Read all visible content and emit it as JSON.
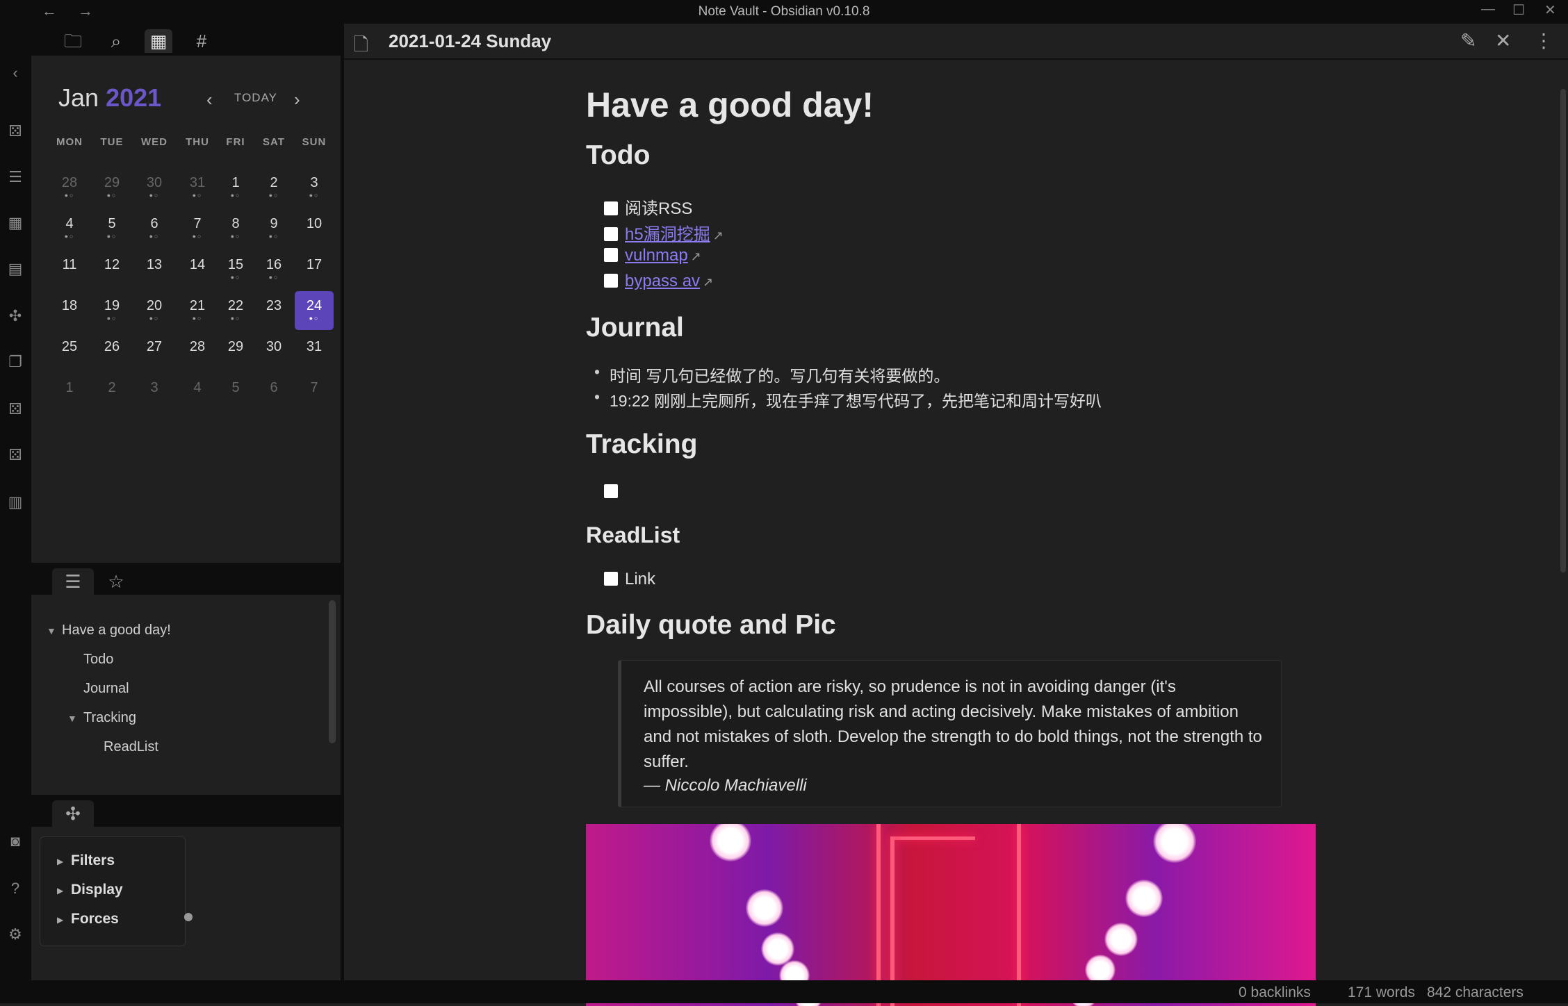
{
  "window": {
    "title": "Note Vault - Obsidian v0.10.8",
    "nav_back": "←",
    "nav_forward": "→",
    "minimize": "—",
    "maximize": "☐",
    "close": "✕"
  },
  "ribbon": {
    "icons": [
      "collapse-left-icon",
      "dice-icon",
      "list-icon",
      "calendar-check-icon",
      "checklist-icon",
      "graph-icon",
      "copy-icon",
      "dice-icon-2",
      "dice-icon-3",
      "table-icon",
      "camera-icon",
      "help-icon",
      "settings-icon"
    ]
  },
  "left_tabs": {
    "icons": [
      "folder-icon",
      "search-icon",
      "calendar-icon",
      "hashtag-icon"
    ],
    "active": "calendar-icon"
  },
  "calendar": {
    "month": "Jan",
    "year": "2021",
    "today_label": "TODAY",
    "prev": "‹",
    "next": "›",
    "weekdays": [
      "MON",
      "TUE",
      "WED",
      "THU",
      "FRI",
      "SAT",
      "SUN"
    ],
    "weeks": [
      [
        {
          "d": "28",
          "dim": true,
          "dots": "●○"
        },
        {
          "d": "29",
          "dim": true,
          "dots": "●○"
        },
        {
          "d": "30",
          "dim": true,
          "dots": "●○"
        },
        {
          "d": "31",
          "dim": true,
          "dots": "●○"
        },
        {
          "d": "1",
          "dots": "●○"
        },
        {
          "d": "2",
          "dots": "●○"
        },
        {
          "d": "3",
          "dots": "●○"
        }
      ],
      [
        {
          "d": "4",
          "dots": "●○"
        },
        {
          "d": "5",
          "dots": "●○"
        },
        {
          "d": "6",
          "dots": "●○"
        },
        {
          "d": "7",
          "dots": "●○"
        },
        {
          "d": "8",
          "dots": "●○"
        },
        {
          "d": "9",
          "dots": "●○"
        },
        {
          "d": "10",
          "dots": ""
        }
      ],
      [
        {
          "d": "11",
          "dots": ""
        },
        {
          "d": "12",
          "dots": ""
        },
        {
          "d": "13",
          "dots": ""
        },
        {
          "d": "14",
          "dots": ""
        },
        {
          "d": "15",
          "dots": "●○"
        },
        {
          "d": "16",
          "dots": "●○"
        },
        {
          "d": "17",
          "dots": ""
        }
      ],
      [
        {
          "d": "18",
          "dots": ""
        },
        {
          "d": "19",
          "dots": "●○"
        },
        {
          "d": "20",
          "dots": "●○"
        },
        {
          "d": "21",
          "dots": "●○"
        },
        {
          "d": "22",
          "dots": "●○"
        },
        {
          "d": "23",
          "dots": ""
        },
        {
          "d": "24",
          "dots": "●○",
          "selected": true
        }
      ],
      [
        {
          "d": "25",
          "dots": ""
        },
        {
          "d": "26",
          "dots": ""
        },
        {
          "d": "27",
          "dots": ""
        },
        {
          "d": "28",
          "dots": ""
        },
        {
          "d": "29",
          "dots": ""
        },
        {
          "d": "30",
          "dots": ""
        },
        {
          "d": "31",
          "dots": ""
        }
      ],
      [
        {
          "d": "1",
          "dim": true,
          "dots": ""
        },
        {
          "d": "2",
          "dim": true,
          "dots": ""
        },
        {
          "d": "3",
          "dim": true,
          "dots": ""
        },
        {
          "d": "4",
          "dim": true,
          "dots": ""
        },
        {
          "d": "5",
          "dim": true,
          "dots": ""
        },
        {
          "d": "6",
          "dim": true,
          "dots": ""
        },
        {
          "d": "7",
          "dim": true,
          "dots": ""
        }
      ]
    ]
  },
  "outline_tabs": {
    "icons": [
      "outline-list-icon",
      "star-icon"
    ]
  },
  "outline": {
    "items": [
      {
        "label": "Have a good day!",
        "level": 0,
        "caret": true
      },
      {
        "label": "Todo",
        "level": 1
      },
      {
        "label": "Journal",
        "level": 1
      },
      {
        "label": "Tracking",
        "level": 1,
        "caret": true
      },
      {
        "label": "ReadList",
        "level": 2
      }
    ]
  },
  "graph_panel": {
    "tab_icon": "graph-icon",
    "controls": [
      "Filters",
      "Display",
      "Forces"
    ]
  },
  "editor": {
    "file_title": "2021-01-24 Sunday",
    "header_buttons": [
      "edit-icon",
      "close-icon",
      "more-options-icon"
    ],
    "h1": "Have a good day!",
    "sections": {
      "todo": {
        "heading": "Todo",
        "tasks": [
          {
            "text": "阅读RSS",
            "link": false
          },
          {
            "text": "h5漏洞挖掘",
            "link": true
          },
          {
            "text": "vulnmap",
            "link": true
          },
          {
            "text": "bypass av",
            "link": true
          }
        ]
      },
      "journal": {
        "heading": "Journal",
        "bullets": [
          "时间 写几句已经做了的。写几句有关将要做的。",
          "19:22 刚刚上完厕所，现在手痒了想写代码了，先把笔记和周计写好叭"
        ]
      },
      "tracking": {
        "heading": "Tracking",
        "tasks": [
          {
            "text": ""
          }
        ]
      },
      "readlist": {
        "heading": "ReadList",
        "tasks": [
          {
            "text": "Link"
          }
        ]
      },
      "daily": {
        "heading": "Daily quote and Pic",
        "quote": "All courses of action are risky, so prudence is not in avoiding danger (it's impossible), but calculating risk and acting decisively. Make mistakes of ambition and not mistakes of sloth. Develop the strength to do bold things, not the strength to suffer.",
        "author": "— Niccolo Machiavelli"
      }
    }
  },
  "status": {
    "backlinks": "0 backlinks",
    "words": "171 words",
    "characters": "842 characters"
  },
  "colors": {
    "accent": "#6c57c9",
    "selected_day": "#5b45b8",
    "link": "#8b7cf0",
    "background": "#202020",
    "chrome": "#0d0d0d"
  }
}
